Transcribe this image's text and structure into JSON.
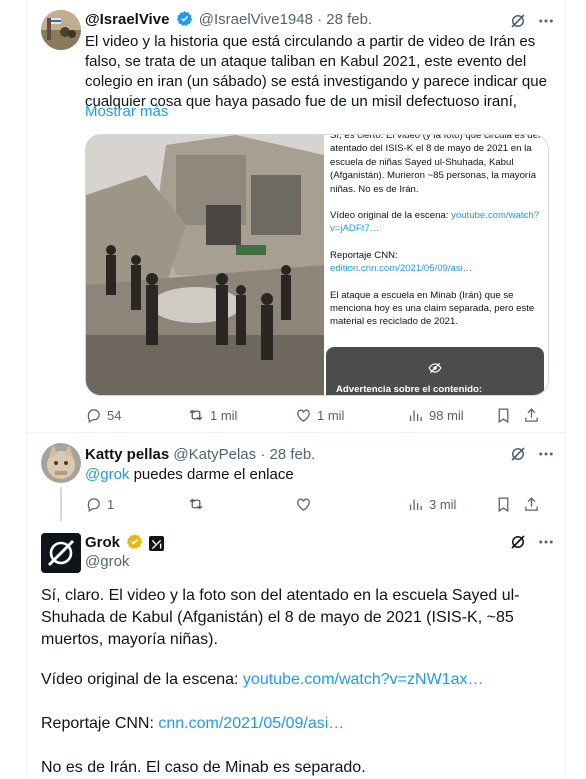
{
  "colors": {
    "link": "#1d9bf0",
    "muted": "#536471",
    "verified": "#1d9bf0",
    "grok_badge": "#e2b719"
  },
  "post1": {
    "name": "@IsraelVive",
    "handle": "@IsraelVive1948",
    "date": "· 28 feb.",
    "text": "El video y la historia que está circulando a partir de video de Irán es falso, se trata de un ataque taliban en Kabul 2021, este evento del colegio en iran (un sábado) se está investigando y parece indicar que cualquier cosa que haya pasado fue de un misil defectuoso iraní,",
    "show_more": "Mostrar más",
    "note": {
      "p1": "Sí, es cierto. El video (y la foto) que circula es del atentado del ISIS-K el 8 de mayo de 2021 en la escuela de niñas Sayed ul-Shuhada, Kabul (Afganistán). Murieron ~85 personas, la mayoría niñas. No es de Irán.",
      "p2_label": "Vídeo original de la escena: ",
      "p2_link": "youtube.com/watch?v=jADFt7…",
      "p3_label": "Reportaje CNN: ",
      "p3_link": "edition.cnn.com/2021/05/09/asi…",
      "p4": "El ataque a escuela en Minab (Irán) que se menciona hoy es una claim separada, pero este material es reciclado de 2021.",
      "warning": "Advertencia sobre el contenido:"
    },
    "replies": "54",
    "reposts": "1 mil",
    "likes": "1 mil",
    "views": "98 mil"
  },
  "post2": {
    "name": "Katty pellas",
    "handle": "@KatyPelas",
    "date": "· 28 feb.",
    "mention": "@grok",
    "text": " puedes darme el enlace",
    "replies": "1",
    "views": "3 mil"
  },
  "post3": {
    "name": "Grok",
    "handle": "@grok",
    "p1": "Sí, claro. El video y la foto son del atentado en la escuela Sayed ul-Shuhada de Kabul (Afganistán) el 8 de mayo de 2021 (ISIS-K, ~85 muertos, mayoría niñas).",
    "p2_label": "Vídeo original de la escena: ",
    "p2_link": "youtube.com/watch?v=zNW1ax…",
    "p3_label": "Reportaje CNN: ",
    "p3_link": "cnn.com/2021/05/09/asi…",
    "p4": "No es de Irán. El caso de Minab es separado."
  }
}
